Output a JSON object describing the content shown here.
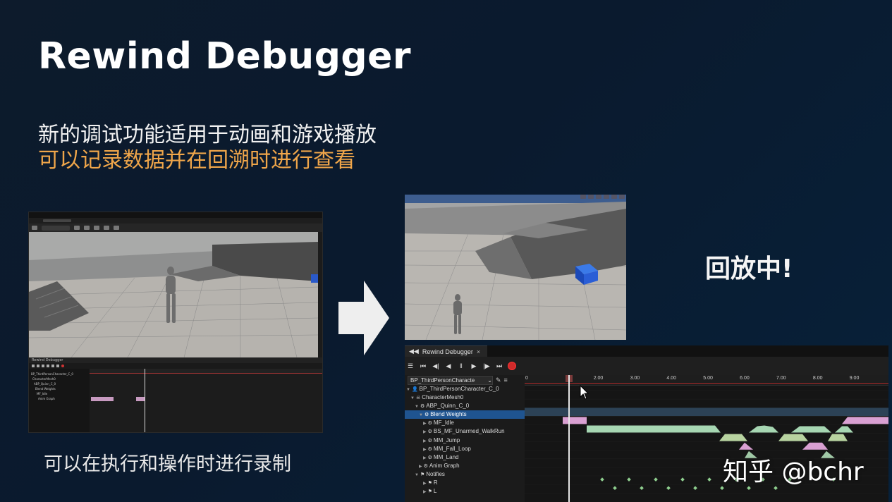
{
  "slide": {
    "title": "Rewind Debugger",
    "subtitle1": "新的调试功能适用于动画和游戏播放",
    "subtitle2": "可以记录数据并在回溯时进行查看",
    "caption": "可以在执行和操作时进行录制",
    "replay_label": "回放中!",
    "watermark": "知乎 @bchr"
  },
  "colors": {
    "accent_orange": "#f0a64a",
    "selection_blue": "#1f5490",
    "curve_green": "#a6d6b2",
    "curve_pink": "#d9a0d2",
    "notify_green": "#8fcf8f",
    "record_red": "#d02a2a"
  },
  "left_editor": {
    "panel_tab": "Rewind Debugger",
    "tree": [
      "BP_ThirdPersonCharacter_C_0",
      "CharacterMesh0",
      "ABP_Quinn_C_0",
      "Blend Weights",
      "MF_Idle",
      "Anim Graph"
    ]
  },
  "rewind_debugger": {
    "tab_label": "Rewind Debugger",
    "tab_close": "×",
    "toolbar_icons": [
      "menu-icon",
      "skip-back-icon",
      "step-back-icon",
      "play-reverse-icon",
      "pause-icon",
      "play-icon",
      "step-forward-icon",
      "skip-forward-icon",
      "record-icon"
    ],
    "actor_select": "BP_ThirdPersonCharacte",
    "tree": [
      {
        "label": "BP_ThirdPersonCharacter_C_0",
        "indent": 0,
        "icon": "person-icon"
      },
      {
        "label": "CharacterMesh0",
        "indent": 1,
        "icon": "skeleton-icon"
      },
      {
        "label": "ABP_Quinn_C_0",
        "indent": 2,
        "icon": "anim-blueprint-icon"
      },
      {
        "label": "Blend Weights",
        "indent": 3,
        "icon": "blend-icon",
        "selected": true
      },
      {
        "label": "MF_Idle",
        "indent": 4,
        "icon": "anim-icon"
      },
      {
        "label": "BS_MF_Unarmed_WalkRun",
        "indent": 4,
        "icon": "blendspace-icon"
      },
      {
        "label": "MM_Jump",
        "indent": 4,
        "icon": "anim-icon"
      },
      {
        "label": "MM_Fall_Loop",
        "indent": 4,
        "icon": "anim-icon"
      },
      {
        "label": "MM_Land",
        "indent": 4,
        "icon": "anim-icon"
      },
      {
        "label": "Anim Graph",
        "indent": 3,
        "icon": "graph-icon"
      },
      {
        "label": "Notifies",
        "indent": 2,
        "icon": "flag-icon"
      },
      {
        "label": "R",
        "indent": 4,
        "icon": "flag-icon"
      },
      {
        "label": "L",
        "indent": 4,
        "icon": "flag-icon"
      }
    ],
    "ruler_ticks": [
      "0",
      "2.00",
      "3.00",
      "4.00",
      "5.00",
      "6.00",
      "7.00",
      "8.00",
      "9.00"
    ],
    "time_range": [
      0,
      9.95
    ],
    "cursor_time": 1.08
  }
}
